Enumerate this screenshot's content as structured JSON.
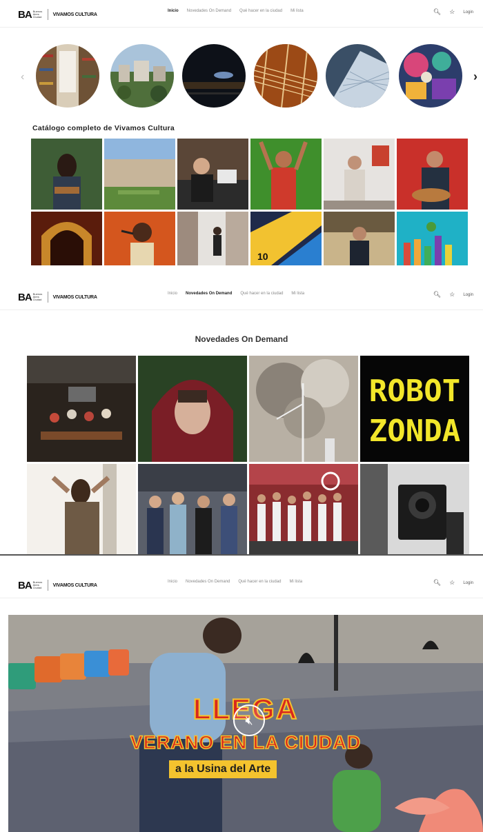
{
  "header": {
    "logo_ba": "BA",
    "logo_ba_sub": "Buenos Aires Ciudad",
    "brand": "VIVAMOS CULTURA",
    "nav": [
      "Inicio",
      "Novedades On Demand",
      "Qué hacer en la ciudad",
      "Mi lista"
    ],
    "login_label": "Login",
    "search_icon": "search-icon",
    "favorites_icon": "star-icon"
  },
  "screen1": {
    "active_nav_index": 0,
    "catalog_title": "Catálogo completo de Vivamos Cultura"
  },
  "screen2": {
    "active_nav_index": 1,
    "section_title": "Novedades On Demand",
    "robot_title": "ROBOT ZONDA"
  },
  "screen3": {
    "hero_line1": "LLEGA",
    "hero_line2": "VERANO EN LA CIUDAD",
    "hero_line3": "a la Usina del Arte",
    "mute_icon": "speaker-mute-icon"
  },
  "colors": {
    "accent_red": "#d8281e",
    "accent_yellow": "#f4c32e",
    "text_dark": "#222222"
  }
}
